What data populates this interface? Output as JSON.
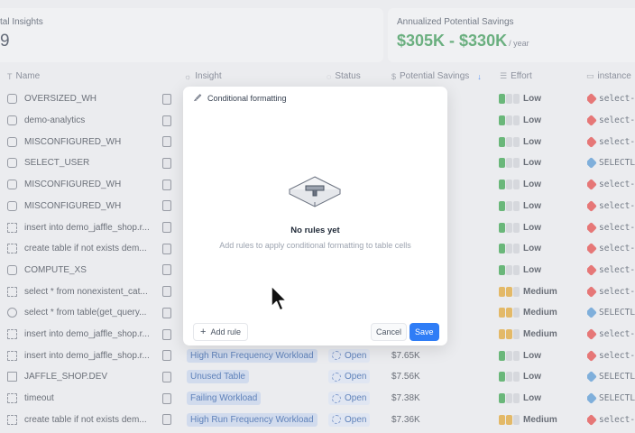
{
  "cards": {
    "total_title": "tal Insights",
    "total_value": "9",
    "savings_title": "Annualized Potential Savings",
    "savings_value": "$305K - $330K",
    "savings_unit": "/ year"
  },
  "columns": {
    "name": "Name",
    "insight": "Insight",
    "status": "Status",
    "savings": "Potential Savings",
    "effort": "Effort",
    "instance": "instance"
  },
  "rows": [
    {
      "name": "OVERSIZED_WH",
      "icon": "warehouse-icon",
      "insight": "",
      "status": "",
      "savings": "",
      "effort": "Low",
      "effort_level": 1,
      "instance": "select-",
      "inst_color": "#e4504f"
    },
    {
      "name": "demo-analytics",
      "icon": "server-icon",
      "insight": "",
      "status": "",
      "savings": "",
      "effort": "Low",
      "effort_level": 1,
      "instance": "select-",
      "inst_color": "#e4504f"
    },
    {
      "name": "MISCONFIGURED_WH",
      "icon": "warehouse-icon",
      "insight": "",
      "status": "",
      "savings": "",
      "effort": "Low",
      "effort_level": 1,
      "instance": "select-",
      "inst_color": "#e4504f"
    },
    {
      "name": "SELECT_USER",
      "icon": "warehouse-icon",
      "insight": "",
      "status": "",
      "savings": "",
      "effort": "Low",
      "effort_level": 1,
      "instance": "SELECTL",
      "inst_color": "#5b9bd5"
    },
    {
      "name": "MISCONFIGURED_WH",
      "icon": "warehouse-icon",
      "insight": "",
      "status": "",
      "savings": "",
      "effort": "Low",
      "effort_level": 1,
      "instance": "select-",
      "inst_color": "#e4504f"
    },
    {
      "name": "MISCONFIGURED_WH",
      "icon": "warehouse-icon",
      "insight": "",
      "status": "",
      "savings": "",
      "effort": "Low",
      "effort_level": 1,
      "instance": "select-",
      "inst_color": "#e4504f"
    },
    {
      "name": "insert into demo_jaffle_shop.r...",
      "icon": "query-icon",
      "insight": "",
      "status": "",
      "savings": "",
      "effort": "Low",
      "effort_level": 1,
      "instance": "select-",
      "inst_color": "#e4504f"
    },
    {
      "name": "create table if not exists dem...",
      "icon": "query-icon",
      "insight": "",
      "status": "",
      "savings": "",
      "effort": "Low",
      "effort_level": 1,
      "instance": "select-",
      "inst_color": "#e4504f"
    },
    {
      "name": "COMPUTE_XS",
      "icon": "warehouse-icon",
      "insight": "",
      "status": "",
      "savings": "",
      "effort": "Low",
      "effort_level": 1,
      "instance": "select-",
      "inst_color": "#e4504f"
    },
    {
      "name": "select * from nonexistent_cat...",
      "icon": "query-icon",
      "insight": "",
      "status": "",
      "savings": "",
      "effort": "Medium",
      "effort_level": 2,
      "instance": "select-",
      "inst_color": "#e4504f"
    },
    {
      "name": "select * from table(get_query...",
      "icon": "fingerprint-icon",
      "insight": "",
      "status": "",
      "savings": "",
      "effort": "Medium",
      "effort_level": 2,
      "instance": "SELECTL",
      "inst_color": "#5b9bd5"
    },
    {
      "name": "insert into demo_jaffle_shop.r...",
      "icon": "query-icon",
      "insight": "",
      "status": "",
      "savings": "",
      "effort": "Medium",
      "effort_level": 2,
      "instance": "select-",
      "inst_color": "#e4504f"
    },
    {
      "name": "insert into demo_jaffle_shop.r...",
      "icon": "query-icon",
      "insight": "High Run Frequency Workload",
      "status": "Open",
      "savings": "$7.65K",
      "effort": "Low",
      "effort_level": 1,
      "instance": "select-",
      "inst_color": "#e4504f"
    },
    {
      "name": "JAFFLE_SHOP.DEV",
      "icon": "table-icon",
      "insight": "Unused Table",
      "status": "Open",
      "savings": "$7.56K",
      "effort": "Low",
      "effort_level": 1,
      "instance": "SELECTL",
      "inst_color": "#5b9bd5"
    },
    {
      "name": "timeout",
      "icon": "query-icon",
      "insight": "Failing Workload",
      "status": "Open",
      "savings": "$7.38K",
      "effort": "Low",
      "effort_level": 1,
      "instance": "SELECTL",
      "inst_color": "#5b9bd5"
    },
    {
      "name": "create table if not exists dem...",
      "icon": "query-icon",
      "insight": "High Run Frequency Workload",
      "status": "Open",
      "savings": "$7.36K",
      "effort": "Medium",
      "effort_level": 2,
      "instance": "select-",
      "inst_color": "#e4504f"
    }
  ],
  "colors": {
    "effort_low": "#3fa653",
    "effort_medium": "#e0a93b",
    "savings_green": "#3f9b5a",
    "primary": "#2f7df6"
  },
  "modal": {
    "title": "Conditional formatting",
    "empty_title": "No rules yet",
    "empty_subtitle": "Add rules to apply conditional formatting to table cells",
    "add_rule": "Add rule",
    "cancel": "Cancel",
    "save": "Save"
  }
}
